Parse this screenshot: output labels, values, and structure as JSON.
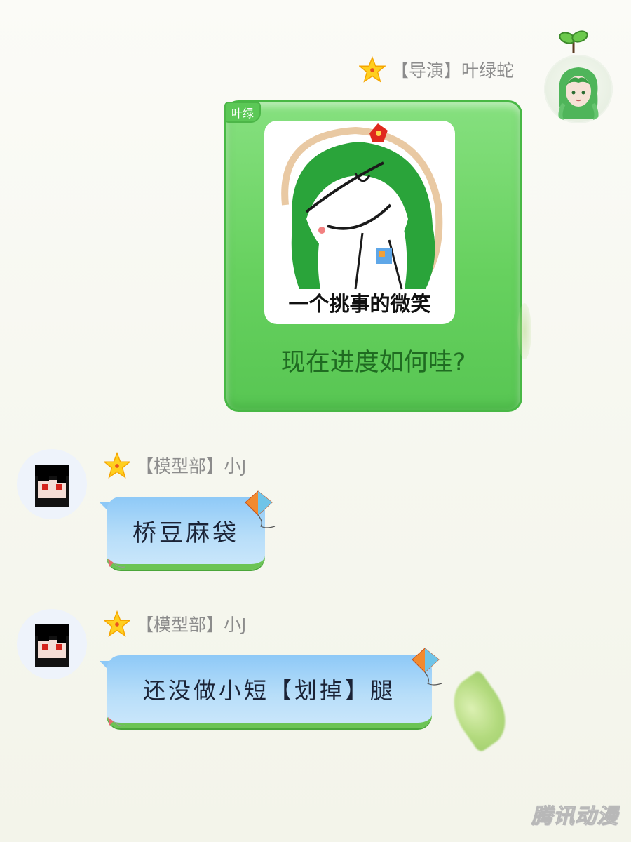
{
  "messages": [
    {
      "sender": {
        "dept": "【导演】",
        "name": "叶绿蛇"
      },
      "bubble_tag": "叶绿",
      "sticker_caption": "一个挑事的微笑",
      "text": "现在进度如何哇?"
    },
    {
      "sender": {
        "dept": "【模型部】",
        "name": "小J"
      },
      "text": "桥豆麻袋"
    },
    {
      "sender": {
        "dept": "【模型部】",
        "name": "小J"
      },
      "text": "还没做小短【划掉】腿"
    }
  ],
  "watermark": "腾讯动漫",
  "colors": {
    "green_bubble": "#67d15f",
    "blue_bubble": "#b8def9",
    "name_text": "#8c8c8c",
    "green_text": "#1f6b21"
  },
  "icons": [
    "star-icon",
    "kite-icon",
    "leaf-decoration",
    "sprout-icon"
  ]
}
